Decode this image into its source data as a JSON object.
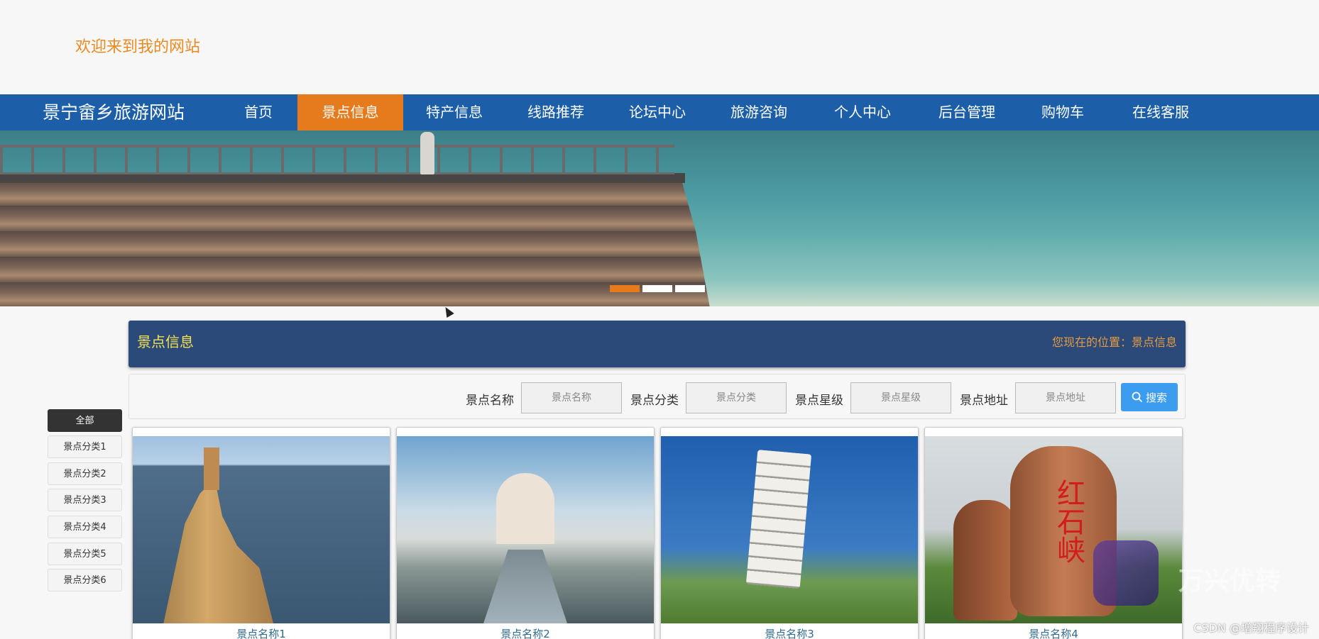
{
  "header": {
    "welcome": "欢迎来到我的网站"
  },
  "nav": {
    "site_name": "景宁畲乡旅游网站",
    "items": [
      {
        "label": "首页"
      },
      {
        "label": "景点信息"
      },
      {
        "label": "特产信息"
      },
      {
        "label": "线路推荐"
      },
      {
        "label": "论坛中心"
      },
      {
        "label": "旅游咨询"
      },
      {
        "label": "个人中心"
      },
      {
        "label": "后台管理"
      },
      {
        "label": "购物车"
      },
      {
        "label": "在线客服"
      }
    ],
    "active_index": 1,
    "active_color": "#e57b1c",
    "bar_color": "#1c5fa8"
  },
  "banner": {
    "slide_count": 3,
    "active_slide": 0
  },
  "panel": {
    "title": "景点信息",
    "location": "您现在的位置：景点信息"
  },
  "search": {
    "fields": [
      {
        "label": "景点名称",
        "placeholder": "景点名称",
        "value": ""
      },
      {
        "label": "景点分类",
        "placeholder": "景点分类",
        "value": ""
      },
      {
        "label": "景点星级",
        "placeholder": "景点星级",
        "value": ""
      },
      {
        "label": "景点地址",
        "placeholder": "景点地址",
        "value": ""
      }
    ],
    "button_label": "搜索",
    "button_icon": "search-icon"
  },
  "categories": [
    {
      "label": "全部",
      "active": true
    },
    {
      "label": "景点分类1",
      "active": false
    },
    {
      "label": "景点分类2",
      "active": false
    },
    {
      "label": "景点分类3",
      "active": false
    },
    {
      "label": "景点分类4",
      "active": false
    },
    {
      "label": "景点分类5",
      "active": false
    },
    {
      "label": "景点分类6",
      "active": false
    }
  ],
  "cards": [
    {
      "name": "景点名称1"
    },
    {
      "name": "景点名称2"
    },
    {
      "name": "景点名称3"
    },
    {
      "name": "景点名称4",
      "image_text": "红石峡"
    }
  ],
  "watermarks": {
    "csdn": "CSDN @增翔程序设计",
    "brand": "万兴优转"
  }
}
